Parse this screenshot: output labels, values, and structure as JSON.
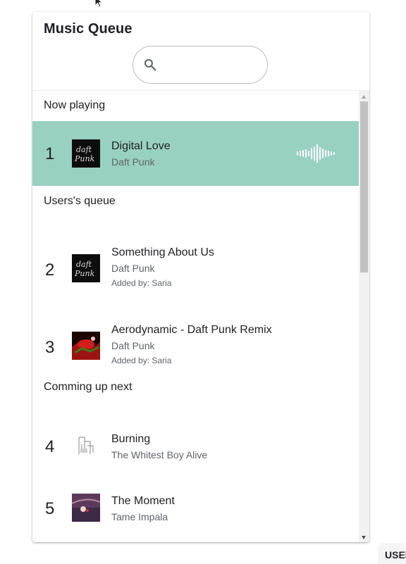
{
  "title": "Music Queue",
  "search": {
    "placeholder": "",
    "value": ""
  },
  "sections": {
    "now_playing": "Now playing",
    "user_queue": "Users's queue",
    "up_next": "Comming up next"
  },
  "tracks": [
    {
      "number": "1",
      "title": "Digital Love",
      "artist": "Daft Punk",
      "added_by": ""
    },
    {
      "number": "2",
      "title": "Something About Us",
      "artist": "Daft Punk",
      "added_by": "Added by: Saria"
    },
    {
      "number": "3",
      "title": "Aerodynamic - Daft Punk Remix",
      "artist": "Daft Punk",
      "added_by": "Added by: Saria"
    },
    {
      "number": "4",
      "title": "Burning",
      "artist": "The Whitest Boy Alive",
      "added_by": ""
    },
    {
      "number": "5",
      "title": "The Moment",
      "artist": "Tame Impala",
      "added_by": ""
    }
  ],
  "colors": {
    "now_playing_background": "#98d1c2",
    "secondary_text": "#5f6368"
  },
  "user_button_label": "USER"
}
